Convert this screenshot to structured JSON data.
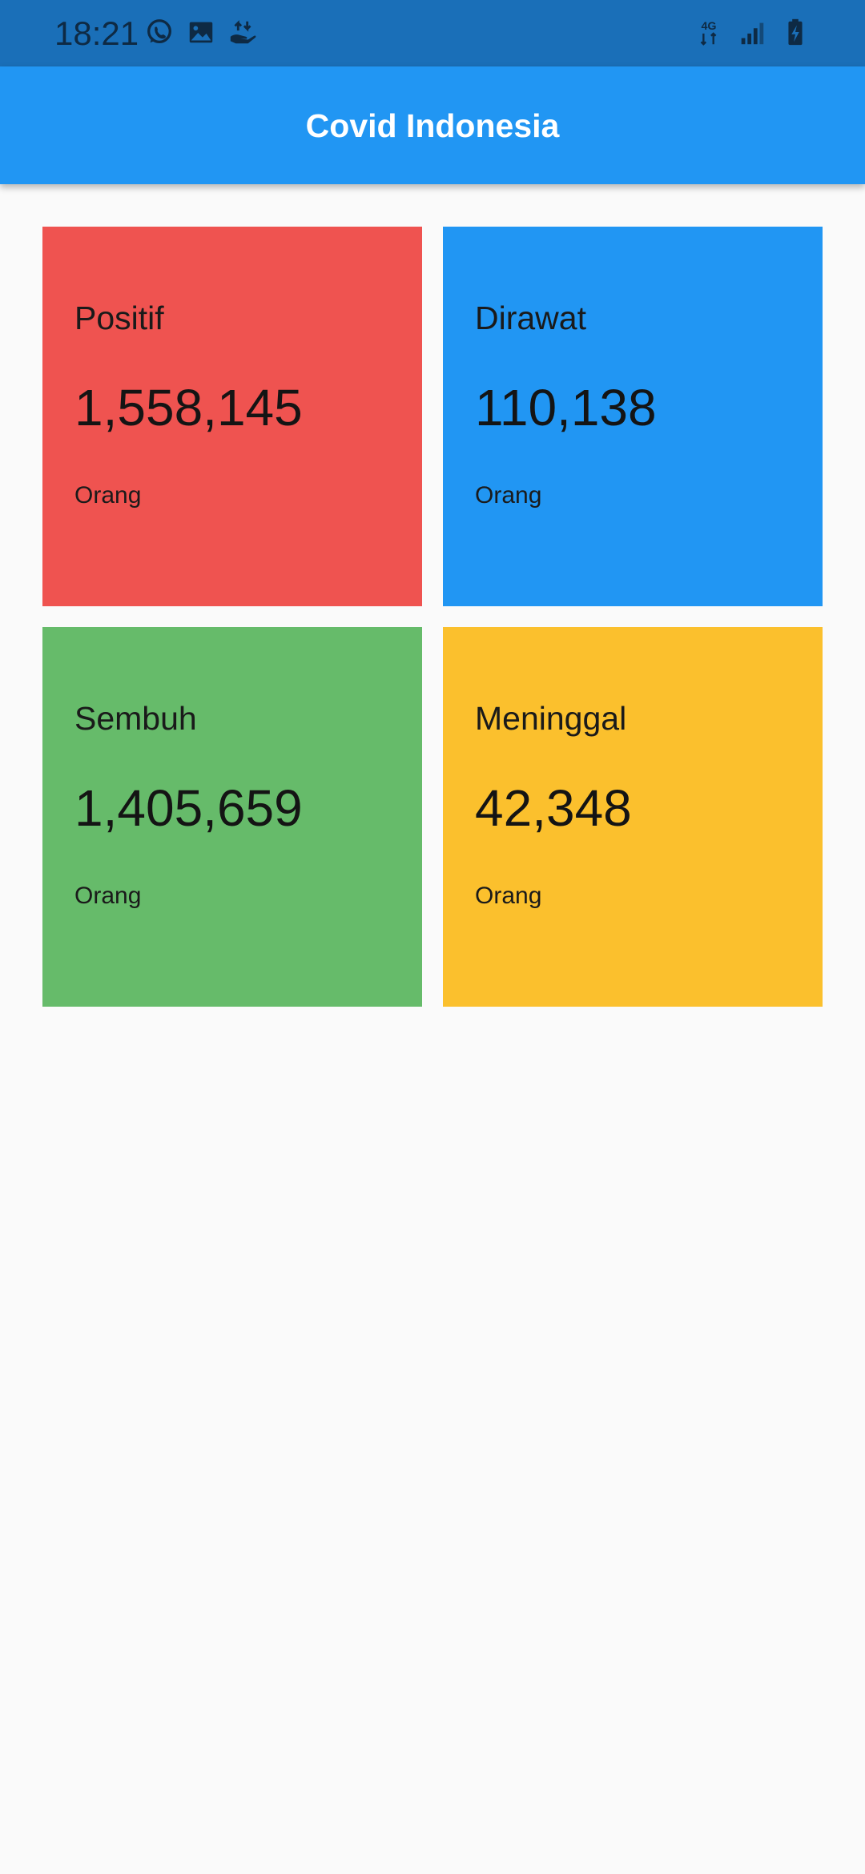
{
  "status_bar": {
    "time": "18:21",
    "left_icons": [
      "whatsapp-icon",
      "image-icon",
      "hand-transfer-icon"
    ],
    "network_label": "4G",
    "right_icons": [
      "network-4g-icon",
      "signal-icon",
      "battery-charging-icon"
    ],
    "background": "#1A6FB8"
  },
  "app_bar": {
    "title": "Covid Indonesia",
    "background": "#2196F3"
  },
  "cards": [
    {
      "label": "Positif",
      "value": "1,558,145",
      "unit": "Orang",
      "color": "#EF5350"
    },
    {
      "label": "Dirawat",
      "value": "110,138",
      "unit": "Orang",
      "color": "#2196F3"
    },
    {
      "label": "Sembuh",
      "value": "1,405,659",
      "unit": "Orang",
      "color": "#66BB6A"
    },
    {
      "label": "Meninggal",
      "value": "42,348",
      "unit": "Orang",
      "color": "#FBC02D"
    }
  ]
}
